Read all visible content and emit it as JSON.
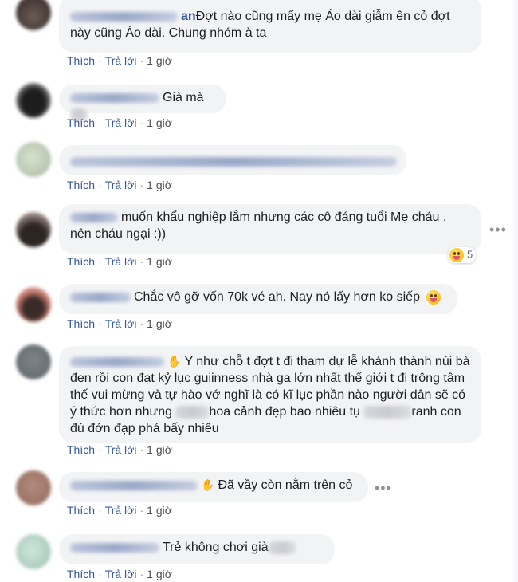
{
  "actions": {
    "like": "Thích",
    "reply": "Trả lời",
    "time": "1 giờ",
    "sep": "·"
  },
  "comments": [
    {
      "name_tail": "an",
      "text": "Đợt nào cũng mấy mẹ Áo dài giẫm ên cỏ đợt này cũng Áo dài. Chung nhóm à ta"
    },
    {
      "text": "Già mà "
    },
    {
      "text": ""
    },
    {
      "text": "muốn khẩu nghiệp lắm nhưng các cô đáng tuổi Mẹ cháu , nên cháu ngại :))",
      "reaction_count": "5"
    },
    {
      "text": "Chắc vô gỡ vốn 70k vé ah. Nay nó lấy hơn ko siếp"
    },
    {
      "text_1": "Y như chỗ t đợt t đi tham dự lễ khánh thành núi bà đen rồi con đạt kỷ lục guiinness nhà ga lớn nhất thế giới t đi trông tâm thế vui mừng và tự hào vớ nghĩ là có kĩ lục phần nào người dân sẽ có ý thức hơn nhưng",
      "text_2": "hoa cảnh đẹp bao nhiêu tụ",
      "text_3": "ranh con đú đởn đạp phá bấy nhiêu"
    },
    {
      "text": "Đã vầy còn nằm trên cỏ"
    },
    {
      "text": "Trẻ không chơi già"
    }
  ],
  "more_icon": "•••",
  "colors": {
    "bubble": "#f2f3f5",
    "link": "#385898",
    "meta": "#90949c"
  }
}
